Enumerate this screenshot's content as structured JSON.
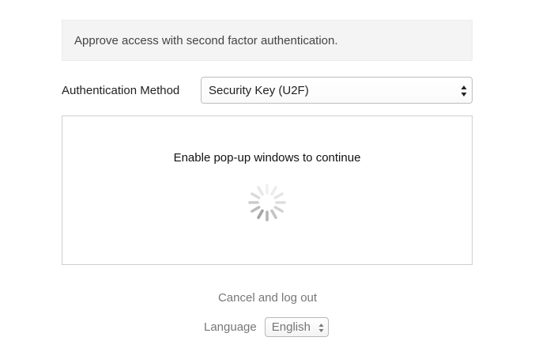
{
  "banner": {
    "text": "Approve access with second factor authentication."
  },
  "auth_method": {
    "label": "Authentication Method",
    "selected": "Security Key (U2F)"
  },
  "popup": {
    "message": "Enable pop-up windows to continue",
    "spinner_icon": "loading-spinner-icon"
  },
  "footer": {
    "cancel_label": "Cancel and log out",
    "language_label": "Language",
    "language_selected": "English"
  }
}
